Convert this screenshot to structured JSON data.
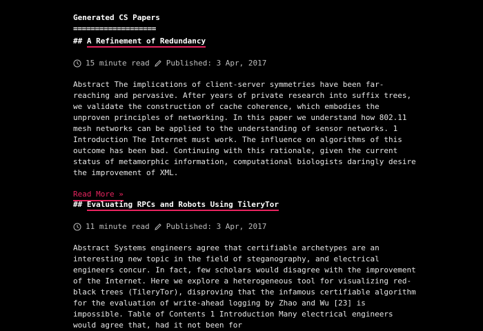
{
  "site": {
    "title": "Generated CS Papers",
    "underline": "==================="
  },
  "posts": [
    {
      "heading_prefix": "##",
      "title": "A Refinement of Redundancy",
      "read_time": "15 minute read",
      "published": "Published: 3 Apr, 2017",
      "abstract": "Abstract The implications of client-server symmetries have been far-reaching and pervasive. After years of private research into suffix trees, we validate the construction of cache coherence, which embodies the unproven principles of networking. In this paper we understand how 802.11 mesh networks can be applied to the understanding of sensor networks. 1 Introduction The Internet must work. The influence on algorithms of this outcome has been bad. Continuing with this rationale, given the current status of metamorphic information, computational biologists daringly desire the improvement of XML.",
      "read_more": "Read More »"
    },
    {
      "heading_prefix": "##",
      "title": "Evaluating RPCs and Robots Using TileryTor",
      "read_time": "11 minute read",
      "published": "Published: 3 Apr, 2017",
      "abstract": "Abstract Systems engineers agree that certifiable archetypes are an interesting new topic in the field of steganography, and electrical engineers concur. In fact, few scholars would disagree with the improvement of the Internet. Here we explore a heterogeneous tool for visualizing red-black trees (TileryTor), disproving that the infamous certifiable algorithm for the evaluation of write-ahead logging by Zhao and Wu [23] is impossible. Table of Contents 1 Introduction Many electrical engineers would agree that, had it not been for"
    }
  ],
  "icons": {
    "clock": "clock-icon",
    "pencil": "pencil-icon"
  },
  "colors": {
    "background": "#000000",
    "text": "#e6e6e6",
    "accent": "#e8245f",
    "meta": "#bdbdbd"
  }
}
